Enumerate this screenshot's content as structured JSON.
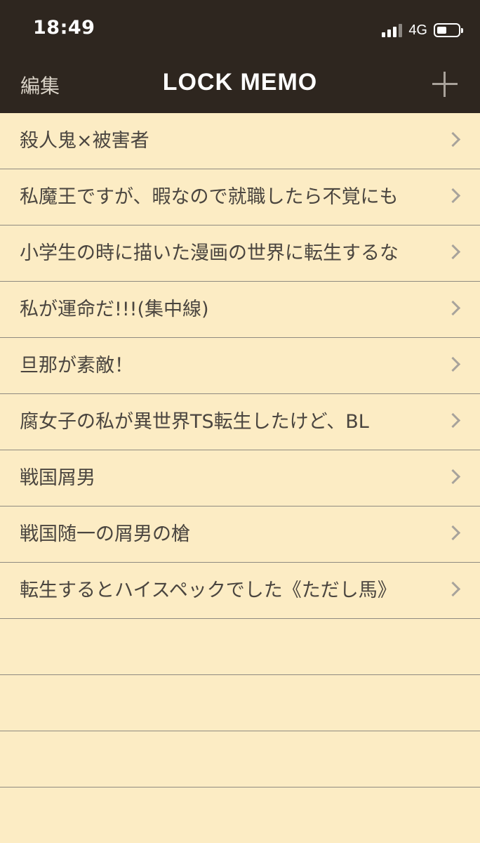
{
  "status_bar": {
    "time": "18:49",
    "network": "4G"
  },
  "nav": {
    "edit_label": "編集",
    "title": "LOCK MEMO",
    "add_icon": "plus-icon"
  },
  "memos": [
    {
      "title": "殺人鬼×被害者"
    },
    {
      "title": "私魔王ですが、暇なので就職したら不覚にも"
    },
    {
      "title": "小学生の時に描いた漫画の世界に転生するな"
    },
    {
      "title": "私が運命だ!!!(集中線)"
    },
    {
      "title": "旦那が素敵！"
    },
    {
      "title": "腐女子の私が異世界TS転生したけど、BL"
    },
    {
      "title": "戦国屑男"
    },
    {
      "title": "戦国随一の屑男の槍"
    },
    {
      "title": "転生するとハイスペックでした《ただし馬》"
    }
  ],
  "colors": {
    "header_bg": "#2e261f",
    "list_bg": "#fcecc4",
    "text": "#4a453f",
    "separator": "#8f8a80"
  }
}
